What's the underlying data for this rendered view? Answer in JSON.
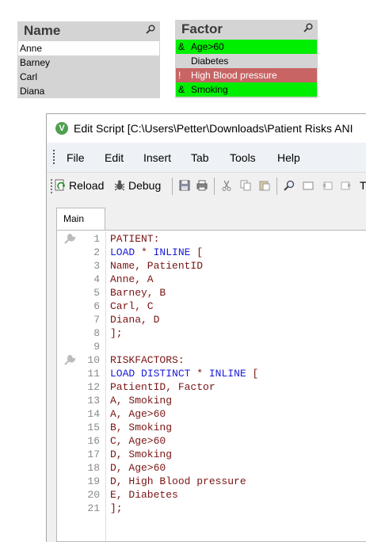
{
  "name_listbox": {
    "title": "Name",
    "items": [
      {
        "label": "Anne",
        "state": "selected"
      },
      {
        "label": "Barney",
        "state": "optional"
      },
      {
        "label": "Carl",
        "state": "optional"
      },
      {
        "label": "Diana",
        "state": "optional"
      }
    ]
  },
  "factor_listbox": {
    "title": "Factor",
    "items": [
      {
        "flag": "&",
        "label": "Age>60",
        "state": "and-selected"
      },
      {
        "flag": "",
        "label": "Diabetes",
        "state": "excluded"
      },
      {
        "flag": "!",
        "label": "High Blood pressure",
        "state": "not-selected"
      },
      {
        "flag": "&",
        "label": "Smoking",
        "state": "and-selected"
      }
    ]
  },
  "colors": {
    "selected_green": "#00ee00",
    "not_red": "#c86464",
    "excluded_grey": "#d4d4d4",
    "keyword_blue": "#1a1ad6",
    "code_text": "#7a1414"
  },
  "window": {
    "app_icon": "V",
    "title": "Edit Script [C:\\Users\\Petter\\Downloads\\Patient Risks ANI"
  },
  "menu": [
    "File",
    "Edit",
    "Insert",
    "Tab",
    "Tools",
    "Help"
  ],
  "toolbar": {
    "reload_label": "Reload",
    "debug_label": "Debug",
    "trailing_label": "T",
    "icons": [
      "reload-icon",
      "debug-icon",
      "save-icon",
      "print-icon",
      "cut-icon",
      "copy-icon",
      "paste-icon",
      "find-icon",
      "open-icon",
      "undo-icon",
      "redo-icon"
    ]
  },
  "tabs": [
    {
      "label": "Main",
      "active": true
    }
  ],
  "script_lines": [
    {
      "n": "1",
      "parts": [
        {
          "t": "PATIENT:",
          "c": "text"
        }
      ],
      "gutter_icon": true
    },
    {
      "n": "2",
      "parts": [
        {
          "t": "LOAD",
          "c": "kw"
        },
        {
          "t": " * ",
          "c": "text"
        },
        {
          "t": "INLINE",
          "c": "kw"
        },
        {
          "t": " [",
          "c": "text"
        }
      ]
    },
    {
      "n": "3",
      "parts": [
        {
          "t": "Name, PatientID",
          "c": "text"
        }
      ]
    },
    {
      "n": "4",
      "parts": [
        {
          "t": "Anne, A",
          "c": "text"
        }
      ]
    },
    {
      "n": "5",
      "parts": [
        {
          "t": "Barney, B",
          "c": "text"
        }
      ]
    },
    {
      "n": "6",
      "parts": [
        {
          "t": "Carl, C",
          "c": "text"
        }
      ]
    },
    {
      "n": "7",
      "parts": [
        {
          "t": "Diana, D",
          "c": "text"
        }
      ]
    },
    {
      "n": "8",
      "parts": [
        {
          "t": "];",
          "c": "text"
        }
      ]
    },
    {
      "n": "9",
      "parts": []
    },
    {
      "n": "10",
      "parts": [
        {
          "t": "RISKFACTORS:",
          "c": "text"
        }
      ],
      "gutter_icon": true
    },
    {
      "n": "11",
      "parts": [
        {
          "t": "LOAD",
          "c": "kw"
        },
        {
          "t": " ",
          "c": "text"
        },
        {
          "t": "DISTINCT",
          "c": "kw"
        },
        {
          "t": " * ",
          "c": "text"
        },
        {
          "t": "INLINE",
          "c": "kw"
        },
        {
          "t": " [",
          "c": "text"
        }
      ]
    },
    {
      "n": "12",
      "parts": [
        {
          "t": "PatientID, Factor",
          "c": "text"
        }
      ]
    },
    {
      "n": "13",
      "parts": [
        {
          "t": "A, Smoking",
          "c": "text"
        }
      ]
    },
    {
      "n": "14",
      "parts": [
        {
          "t": "A, Age>60",
          "c": "text"
        }
      ]
    },
    {
      "n": "15",
      "parts": [
        {
          "t": "B, Smoking",
          "c": "text"
        }
      ]
    },
    {
      "n": "16",
      "parts": [
        {
          "t": "C, Age>60",
          "c": "text"
        }
      ]
    },
    {
      "n": "17",
      "parts": [
        {
          "t": "D, Smoking",
          "c": "text"
        }
      ]
    },
    {
      "n": "18",
      "parts": [
        {
          "t": "D, Age>60",
          "c": "text"
        }
      ]
    },
    {
      "n": "19",
      "parts": [
        {
          "t": "D, High Blood pressure",
          "c": "text"
        }
      ]
    },
    {
      "n": "20",
      "parts": [
        {
          "t": "E, Diabetes",
          "c": "text"
        }
      ]
    },
    {
      "n": "21",
      "parts": [
        {
          "t": "];",
          "c": "text"
        }
      ]
    }
  ]
}
